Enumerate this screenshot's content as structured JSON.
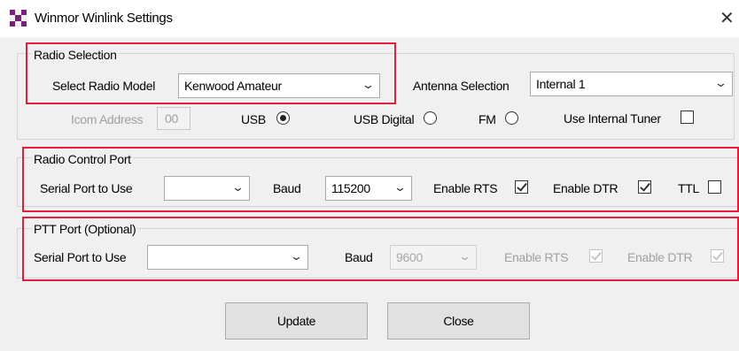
{
  "window": {
    "title": "Winmor Winlink Settings",
    "close_glyph": "✕"
  },
  "radio_selection": {
    "title": "Radio Selection",
    "select_model_label": "Select Radio Model",
    "model_value": "Kenwood Amateur",
    "antenna_label": "Antenna Selection",
    "antenna_value": "Internal 1",
    "icom_label": "Icom Address",
    "icom_value": "00",
    "usb_label": "USB",
    "usb_digital_label": "USB Digital",
    "fm_label": "FM",
    "internal_tuner_label": "Use Internal Tuner",
    "selected_mode": "USB"
  },
  "radio_control": {
    "title": "Radio Control Port",
    "serial_label": "Serial Port to Use",
    "serial_value": "",
    "baud_label": "Baud",
    "baud_value": "115200",
    "rts_label": "Enable RTS",
    "rts_checked": true,
    "dtr_label": "Enable DTR",
    "dtr_checked": true,
    "ttl_label": "TTL",
    "ttl_checked": false
  },
  "ptt": {
    "title": "PTT Port (Optional)",
    "serial_label": "Serial Port to Use",
    "serial_value": "",
    "baud_label": "Baud",
    "baud_value": "9600",
    "rts_label": "Enable RTS",
    "rts_checked": true,
    "dtr_label": "Enable DTR",
    "dtr_checked": true
  },
  "buttons": {
    "update": "Update",
    "close": "Close"
  },
  "colors": {
    "highlight": "#e31e3c",
    "window_bg": "#f0f0f0"
  },
  "glyphs": {
    "dropdown": "⌄"
  }
}
